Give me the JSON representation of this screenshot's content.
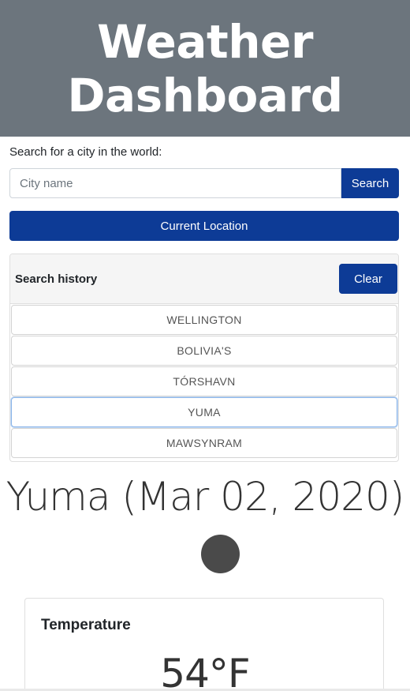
{
  "header": {
    "title": "Weather Dashboard"
  },
  "search": {
    "label": "Search for a city in the world:",
    "placeholder": "City name",
    "value": "",
    "button_label": "Search"
  },
  "location_button_label": "Current Location",
  "history": {
    "title": "Search history",
    "clear_label": "Clear",
    "items": [
      "WELLINGTON",
      "BOLIVIA'S",
      "TÓRSHAVN",
      "YUMA",
      "MAWSYNRAM"
    ],
    "active_index": 3
  },
  "current": {
    "city_date": "Yuma (Mar 02, 2020)",
    "icon": "weather-icon"
  },
  "temperature": {
    "label": "Temperature",
    "value": "54°F"
  },
  "colors": {
    "header_bg": "#6c757d",
    "primary": "#0d3b96"
  }
}
